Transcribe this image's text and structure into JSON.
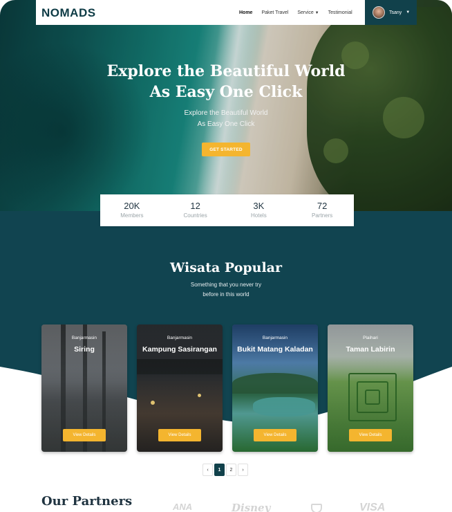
{
  "brand": {
    "logo_text": "NOMADS"
  },
  "navbar": {
    "links": [
      {
        "label": "Home",
        "active": true
      },
      {
        "label": "Paket Travel",
        "active": false
      },
      {
        "label": "Service",
        "active": false,
        "dropdown": true
      },
      {
        "label": "Testimonial",
        "active": false
      }
    ],
    "user": {
      "name": "Tsany"
    }
  },
  "hero": {
    "title_line1": "Explore the Beautiful World",
    "title_line2": "As Easy One Click",
    "subtitle_line1": "Explore the Beautiful World",
    "subtitle_line2": "As Easy One Click",
    "cta_label": "GET STARTED"
  },
  "stats": [
    {
      "value": "20K",
      "label": "Members"
    },
    {
      "value": "12",
      "label": "Countries"
    },
    {
      "value": "3K",
      "label": "Hotels"
    },
    {
      "value": "72",
      "label": "Partners"
    }
  ],
  "popular": {
    "title": "Wisata Popular",
    "subtitle_line1": "Something that you never try",
    "subtitle_line2": "before in this world",
    "cards": [
      {
        "city": "Banjarmasin",
        "name": "Siring",
        "button": "View Details"
      },
      {
        "city": "Banjarmasin",
        "name": "Kampung Sasirangan",
        "button": "View Details"
      },
      {
        "city": "Banjarmasin",
        "name": "Bukit Matang Kaladan",
        "button": "View Details"
      },
      {
        "city": "Plaihari",
        "name": "Taman Labirin",
        "button": "View Details"
      }
    ]
  },
  "pagination": {
    "prev": "‹",
    "pages": [
      "1",
      "2"
    ],
    "current": "1",
    "next": "›"
  },
  "partners": {
    "title": "Our Partners",
    "logos": [
      "ANA",
      "Disney",
      "VISA"
    ]
  },
  "colors": {
    "primary": "#11414b",
    "accent": "#f4b52f"
  }
}
